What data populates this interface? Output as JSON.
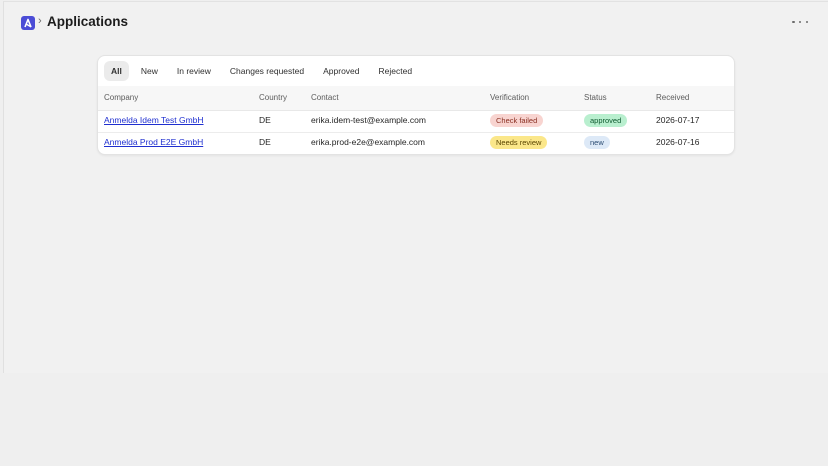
{
  "header": {
    "breadcrumb_separator": "›",
    "title": "Applications",
    "logo_icon": "app-logo-icon",
    "more_icon": "more-horizontal-icon"
  },
  "tabs": [
    {
      "label": "All",
      "active": true
    },
    {
      "label": "New",
      "active": false
    },
    {
      "label": "In review",
      "active": false
    },
    {
      "label": "Changes requested",
      "active": false
    },
    {
      "label": "Approved",
      "active": false
    },
    {
      "label": "Rejected",
      "active": false
    }
  ],
  "table": {
    "columns": {
      "company": "Company",
      "country": "Country",
      "contact": "Contact",
      "verification": "Verification",
      "status": "Status",
      "received": "Received"
    },
    "rows": [
      {
        "company": "Anmelda Idem Test GmbH",
        "country": "DE",
        "contact": "erika.idem-test@example.com",
        "verification": "Check failed",
        "status": "approved",
        "received": "2026-07-17"
      },
      {
        "company": "Anmelda Prod E2E GmbH",
        "country": "DE",
        "contact": "erika.prod-e2e@example.com",
        "verification": "Needs review",
        "status": "new",
        "received": "2026-07-16"
      }
    ]
  },
  "colors": {
    "brand": "#4b4cd6",
    "link": "#1f2fd0",
    "check_failed_bg": "#f8d4d0",
    "check_failed_text": "#8a2f22",
    "needs_review_bg": "#fbe78a",
    "needs_review_text": "#5a4500",
    "approved_bg": "#b9efcf",
    "approved_text": "#0f5a30",
    "new_bg": "#dde9f7",
    "new_text": "#2b4c72"
  }
}
